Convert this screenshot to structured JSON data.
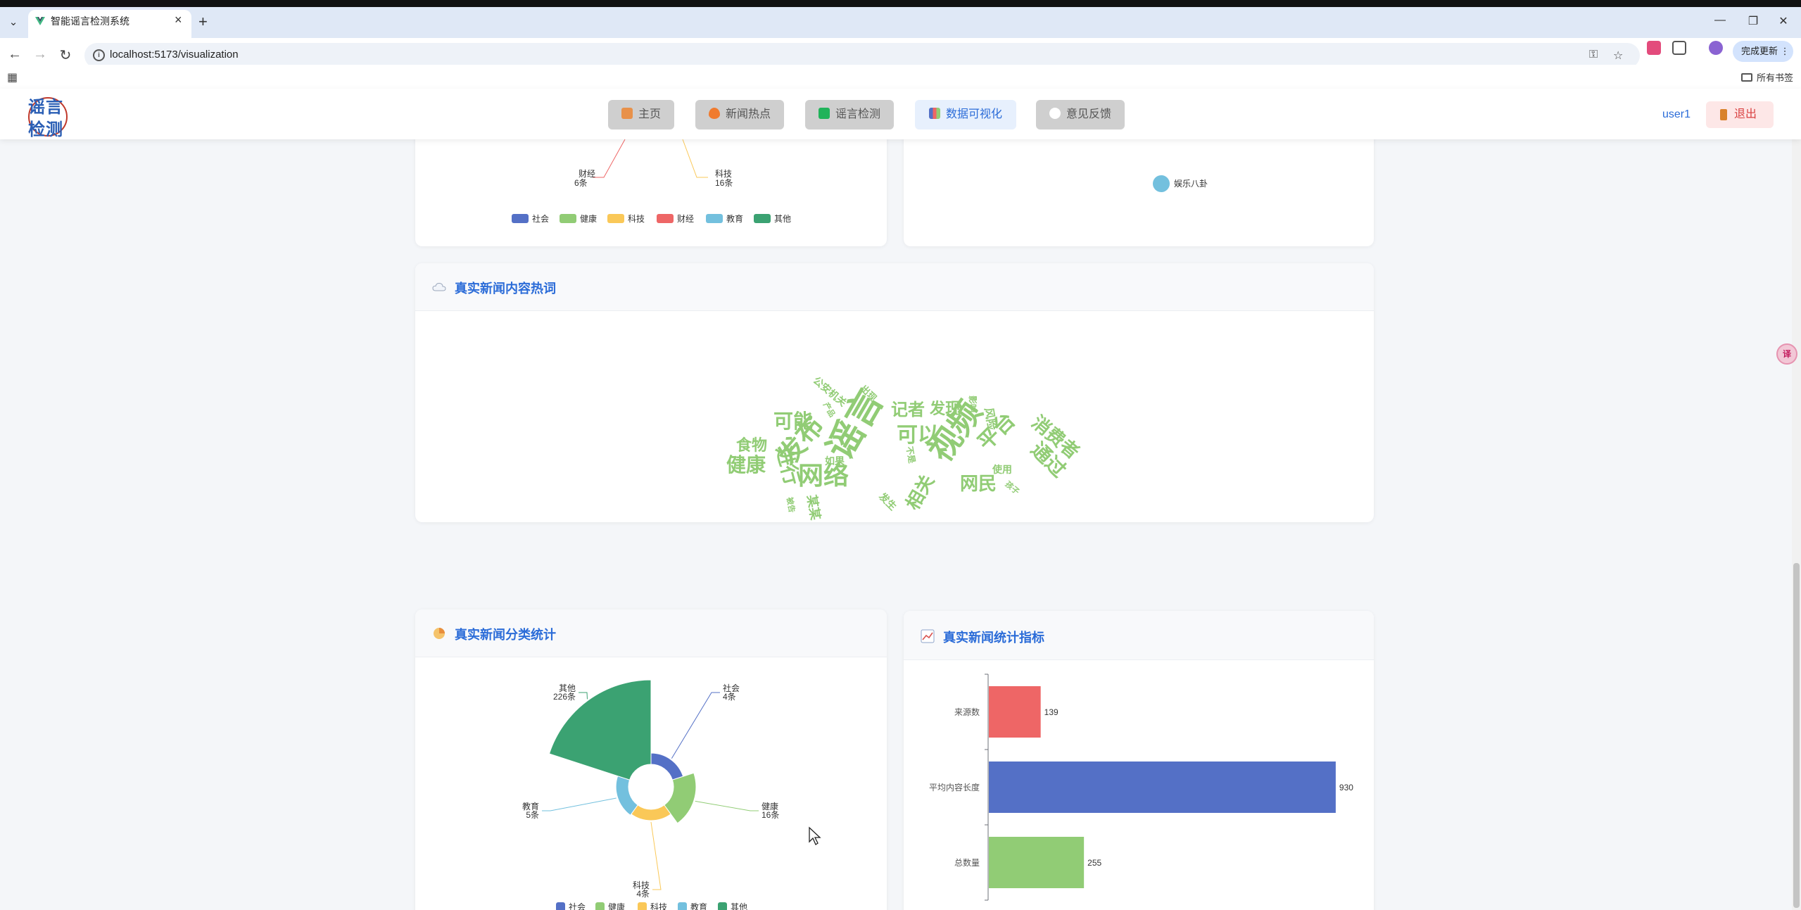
{
  "browser": {
    "tab_title": "智能谣言检测系统",
    "url": "localhost:5173/visualization",
    "update_button": "完成更新",
    "all_bookmarks": "所有书签"
  },
  "header": {
    "logo_line1": "谣言",
    "logo_line2": "检测",
    "nav": [
      {
        "label": "主页",
        "icon": "home-icon"
      },
      {
        "label": "新闻热点",
        "icon": "fire-icon"
      },
      {
        "label": "谣言检测",
        "icon": "check-icon"
      },
      {
        "label": "数据可视化",
        "icon": "bar-chart-icon"
      },
      {
        "label": "意见反馈",
        "icon": "speech-bubble-icon"
      }
    ],
    "username": "user1",
    "logout": "退出"
  },
  "colors": {
    "blue": "#5470c6",
    "green": "#91cc75",
    "yellow": "#fac858",
    "red": "#ee6666",
    "cyan": "#73c0de",
    "dark_green": "#3ba272",
    "accent": "#2b6cd8"
  },
  "top_left_card": {
    "labels": [
      {
        "name": "财经",
        "count": "6条"
      },
      {
        "name": "科技",
        "count": "16条"
      }
    ],
    "legend": [
      "社会",
      "健康",
      "科技",
      "财经",
      "教育",
      "其他"
    ]
  },
  "top_right_card": {
    "legend_label": "娱乐八卦"
  },
  "wordcloud_card": {
    "title": "真实新闻内容热词",
    "words": [
      "谣言",
      "视频",
      "发布",
      "网络",
      "进行",
      "健康",
      "可能",
      "食物",
      "记者",
      "发现",
      "可以",
      "平台",
      "消费者",
      "通过",
      "网民",
      "相关",
      "如果",
      "公安机关",
      "出现",
      "使用",
      "某某",
      "发生",
      "风险",
      "产品",
      "影响",
      "不是",
      "孩子",
      "被告"
    ]
  },
  "category_card": {
    "title": "真实新闻分类统计",
    "chart_data": {
      "type": "pie",
      "rose": true,
      "categories": [
        "社会",
        "健康",
        "科技",
        "教育",
        "其他"
      ],
      "values": [
        4,
        16,
        4,
        5,
        226
      ],
      "unit": "条",
      "legend": [
        "社会",
        "健康",
        "科技",
        "教育",
        "其他"
      ],
      "legend_placement": "bottom"
    }
  },
  "stats_card": {
    "title": "真实新闻统计指标",
    "chart_data": {
      "type": "bar",
      "orientation": "horizontal",
      "categories": [
        "来源数",
        "平均内容长度",
        "总数量"
      ],
      "values": [
        139,
        930,
        255
      ],
      "xlim": [
        0,
        1000
      ]
    }
  }
}
